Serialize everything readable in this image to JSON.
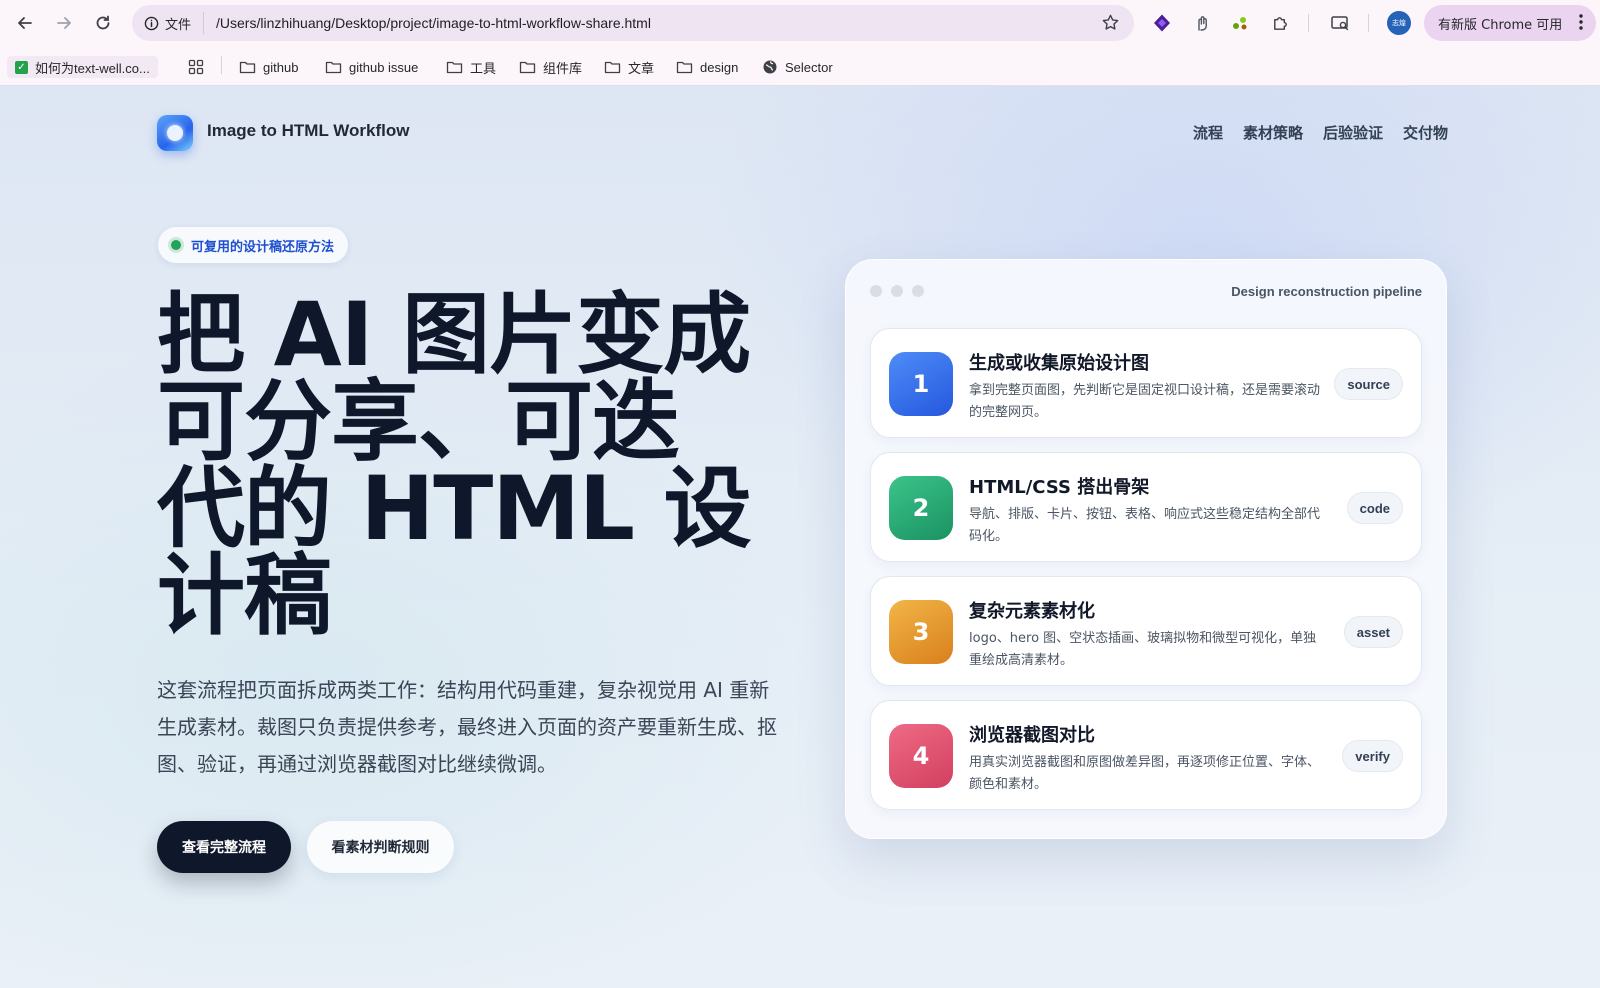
{
  "browser": {
    "url_label": "文件",
    "url": "/Users/linzhihuang/Desktop/project/image-to-html-workflow-share.html",
    "avatar_text": "志煌",
    "update_label": "有新版 Chrome 可用"
  },
  "bookmarks": {
    "first": "如何为text-well.co...",
    "items": [
      "github",
      "github issue",
      "工具",
      "组件库",
      "文章",
      "design"
    ],
    "selector": "Selector"
  },
  "header": {
    "brand": "Image to HTML Workflow",
    "nav": [
      "流程",
      "素材策略",
      "后验验证",
      "交付物"
    ]
  },
  "hero": {
    "badge": "可复用的设计稿还原方法",
    "title_lines": [
      "把 AI 图片变成",
      "可分享、可迭",
      "代的 HTML 设",
      "计稿"
    ],
    "desc": "这套流程把页面拆成两类工作：结构用代码重建，复杂视觉用 AI 重新生成素材。裁图只负责提供参考，最终进入页面的资产要重新生成、抠图、验证，再通过浏览器截图对比继续微调。",
    "primary_btn": "查看完整流程",
    "secondary_btn": "看素材判断规则"
  },
  "pipeline": {
    "title": "Design reconstruction pipeline",
    "steps": [
      {
        "num": "1",
        "title": "生成或收集原始设计图",
        "desc": "拿到完整页面图，先判断它是固定视口设计稿，还是需要滚动的完整网页。",
        "tag": "source",
        "color": "#2f6bea"
      },
      {
        "num": "2",
        "title": "HTML/CSS 搭出骨架",
        "desc": "导航、排版、卡片、按钮、表格、响应式这些稳定结构全部代码化。",
        "tag": "code",
        "color": "#24a873"
      },
      {
        "num": "3",
        "title": "复杂元素素材化",
        "desc": "logo、hero 图、空状态插画、玻璃拟物和微型可视化，单独重绘成高清素材。",
        "tag": "asset",
        "color": "#e4962a"
      },
      {
        "num": "4",
        "title": "浏览器截图对比",
        "desc": "用真实浏览器截图和原图做差异图，再逐项修正位置、字体、颜色和素材。",
        "tag": "verify",
        "color": "#e0536e"
      }
    ]
  }
}
